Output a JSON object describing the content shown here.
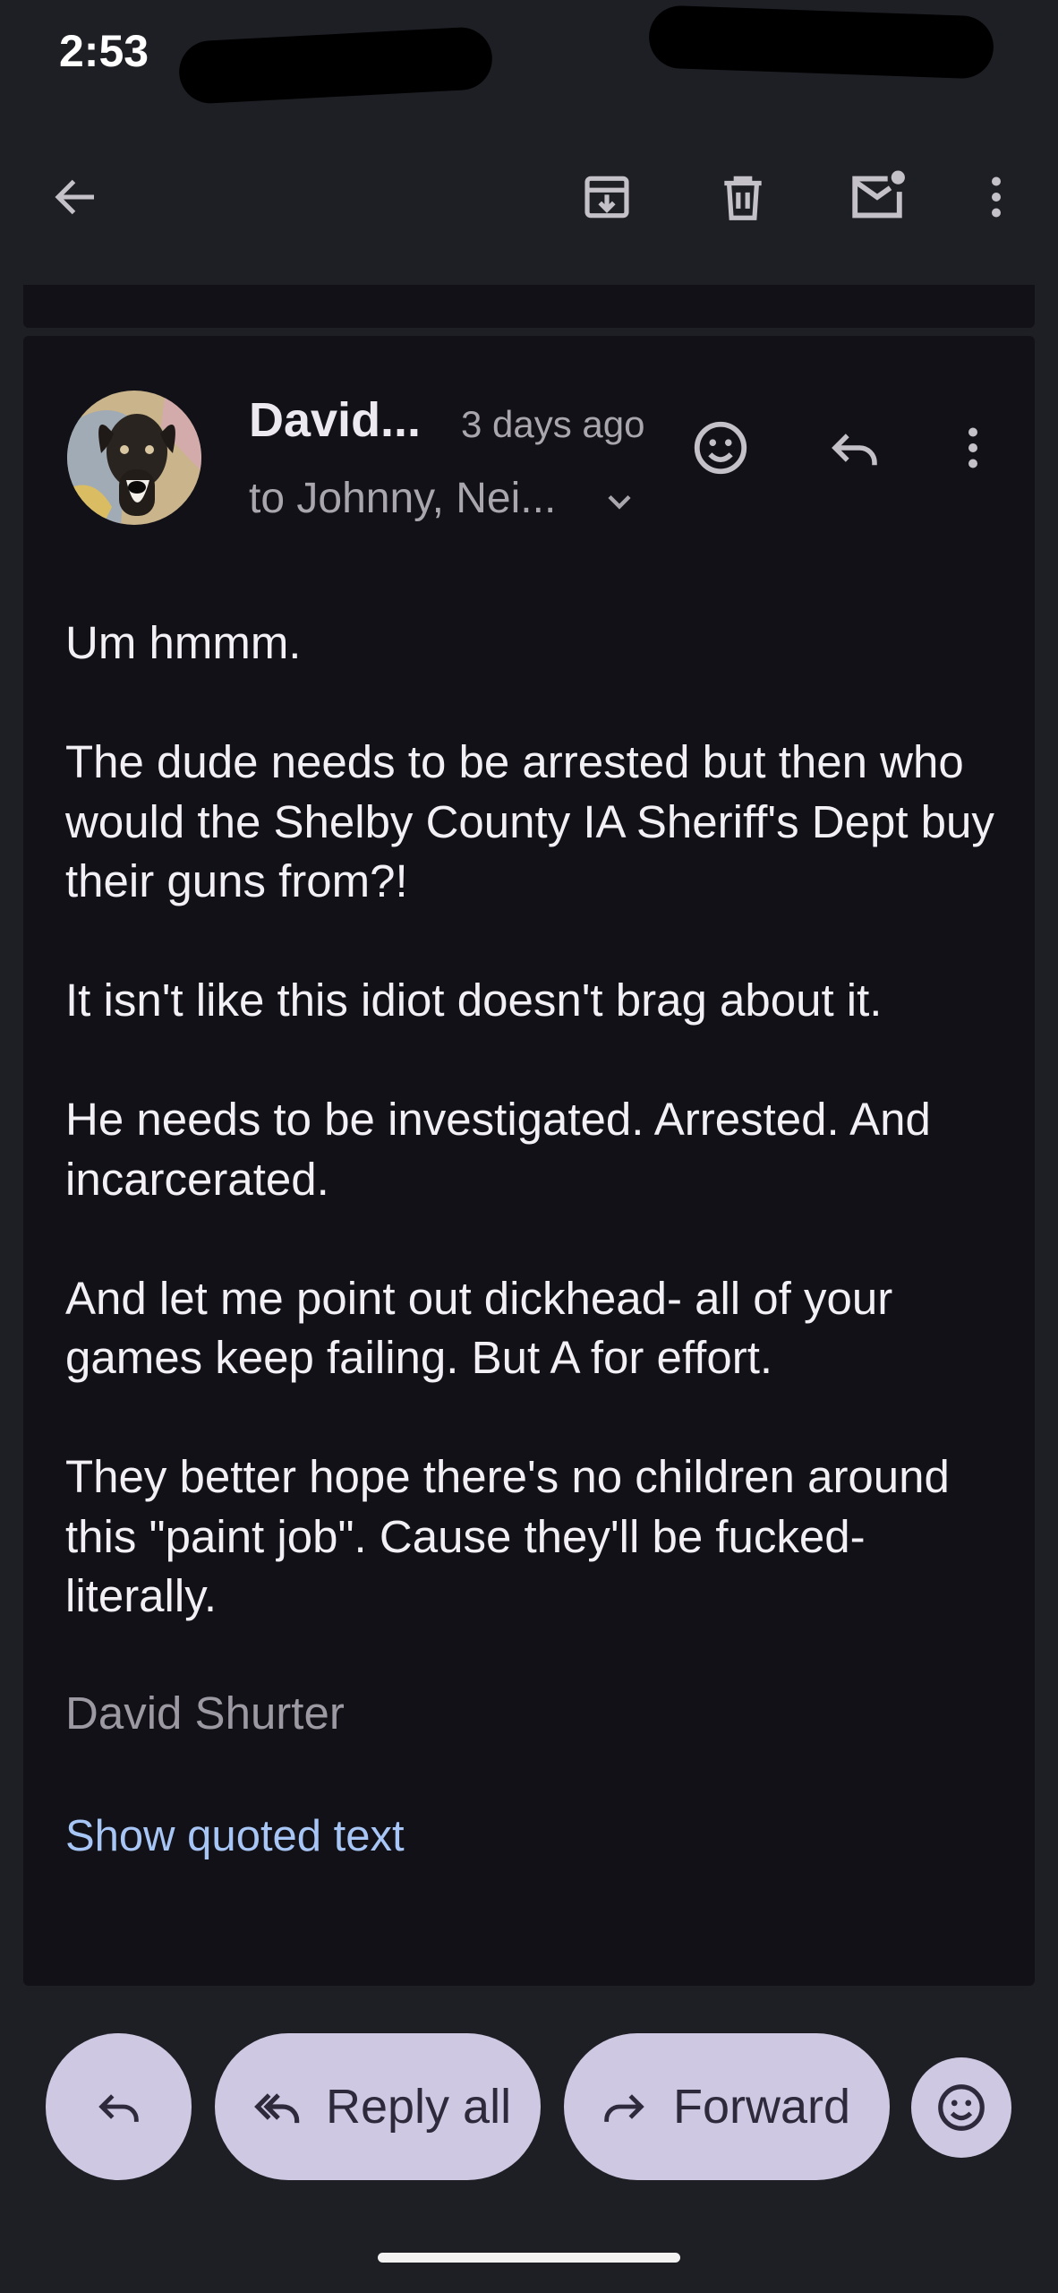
{
  "status_bar": {
    "time": "2:53"
  },
  "toolbar": {
    "back_icon": "arrow-back-icon",
    "archive_icon": "archive-icon",
    "delete_icon": "trash-icon",
    "mark_unread_icon": "mail-unread-icon",
    "more_icon": "more-vert-icon"
  },
  "message": {
    "sender": "David...",
    "time_ago": "3 days ago",
    "recipients": "to Johnny, Nei...",
    "body": [
      "Um hmmm.",
      "The dude needs to be arrested but then who would the Shelby County IA Sheriff's Dept buy their guns from?!",
      "It isn't like this idiot doesn't brag about it.",
      "He needs to be investigated. Arrested. And incarcerated.",
      "And let me point out dickhead- all of your games keep failing. But A for effort.",
      "They better hope there's no children around this \"paint job\". Cause they'll be fucked- literally."
    ],
    "signature": "David Shurter",
    "show_quoted": "Show quoted text"
  },
  "actions": {
    "reply_all_label": "Reply all",
    "forward_label": "Forward"
  },
  "colors": {
    "background": "#1e1f25",
    "card": "#121117",
    "pill": "#cec8e2",
    "link": "#a8c6f5"
  }
}
